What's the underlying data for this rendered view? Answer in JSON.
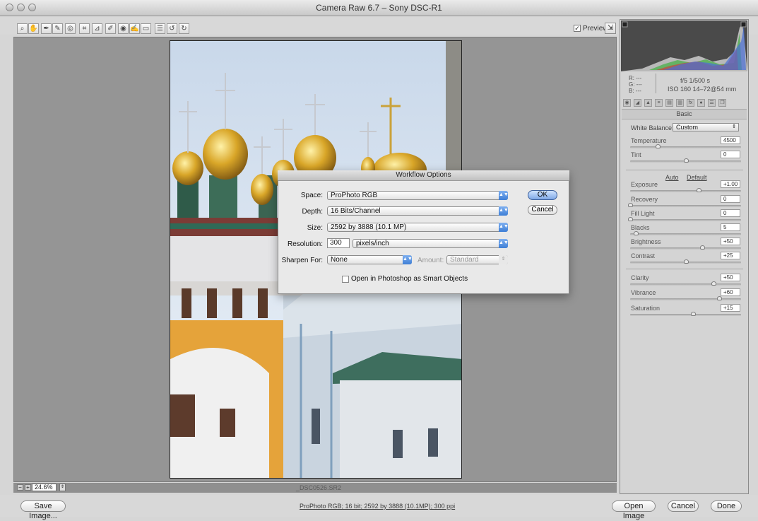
{
  "window": {
    "title": "Camera Raw 6.7  –  Sony DSC-R1"
  },
  "toolbar": {
    "tools": [
      "zoom-tool",
      "hand-tool",
      "white-balance-tool",
      "color-sampler-tool",
      "targeted-adjustment-tool",
      "crop-tool",
      "straighten-tool",
      "spot-removal-tool",
      "red-eye-tool",
      "adjustment-brush-tool",
      "graduated-filter-tool",
      "preferences",
      "rotate-ccw",
      "rotate-cw"
    ],
    "preview_label": "Preview",
    "preview_checked": true
  },
  "canvas": {
    "zoom": "24.6%",
    "filename": "_DSC0526.SR2"
  },
  "panel": {
    "readout": {
      "r": "R:  ---",
      "g": "G:  ---",
      "b": "B:  ---",
      "aperture_shutter": "f/5   1/500 s",
      "iso_lens": "ISO 160   14–72@54 mm"
    },
    "section_title": "Basic",
    "white_balance_label": "White Balance:",
    "white_balance_value": "Custom",
    "auto_label": "Auto",
    "default_label": "Default",
    "sliders": [
      {
        "label": "Temperature",
        "value": "4500",
        "fraction": 0.25
      },
      {
        "label": "Tint",
        "value": "0",
        "fraction": 0.5
      },
      {
        "label": "Exposure",
        "value": "+1.00",
        "fraction": 0.62
      },
      {
        "label": "Recovery",
        "value": "0",
        "fraction": 0.0
      },
      {
        "label": "Fill Light",
        "value": "0",
        "fraction": 0.0
      },
      {
        "label": "Blacks",
        "value": "5",
        "fraction": 0.05
      },
      {
        "label": "Brightness",
        "value": "+50",
        "fraction": 0.65
      },
      {
        "label": "Contrast",
        "value": "+25",
        "fraction": 0.5
      },
      {
        "label": "Clarity",
        "value": "+50",
        "fraction": 0.75
      },
      {
        "label": "Vibrance",
        "value": "+60",
        "fraction": 0.8
      },
      {
        "label": "Saturation",
        "value": "+15",
        "fraction": 0.57
      }
    ]
  },
  "dialog": {
    "title": "Workflow Options",
    "space_label": "Space:",
    "space_value": "ProPhoto RGB",
    "depth_label": "Depth:",
    "depth_value": "16 Bits/Channel",
    "size_label": "Size:",
    "size_value": "2592 by 3888  (10.1 MP)",
    "resolution_label": "Resolution:",
    "resolution_value": "300",
    "resolution_unit": "pixels/inch",
    "sharpen_label": "Sharpen For:",
    "sharpen_value": "None",
    "amount_label": "Amount:",
    "amount_value": "Standard",
    "ok_label": "OK",
    "cancel_label": "Cancel",
    "smart_objects_label": "Open in Photoshop as Smart Objects"
  },
  "bottom": {
    "save_label": "Save Image...",
    "workflow_link": "ProPhoto RGB; 16 bit; 2592 by 3888 (10.1MP); 300 ppi",
    "open_label": "Open Image",
    "cancel_label": "Cancel",
    "done_label": "Done"
  }
}
